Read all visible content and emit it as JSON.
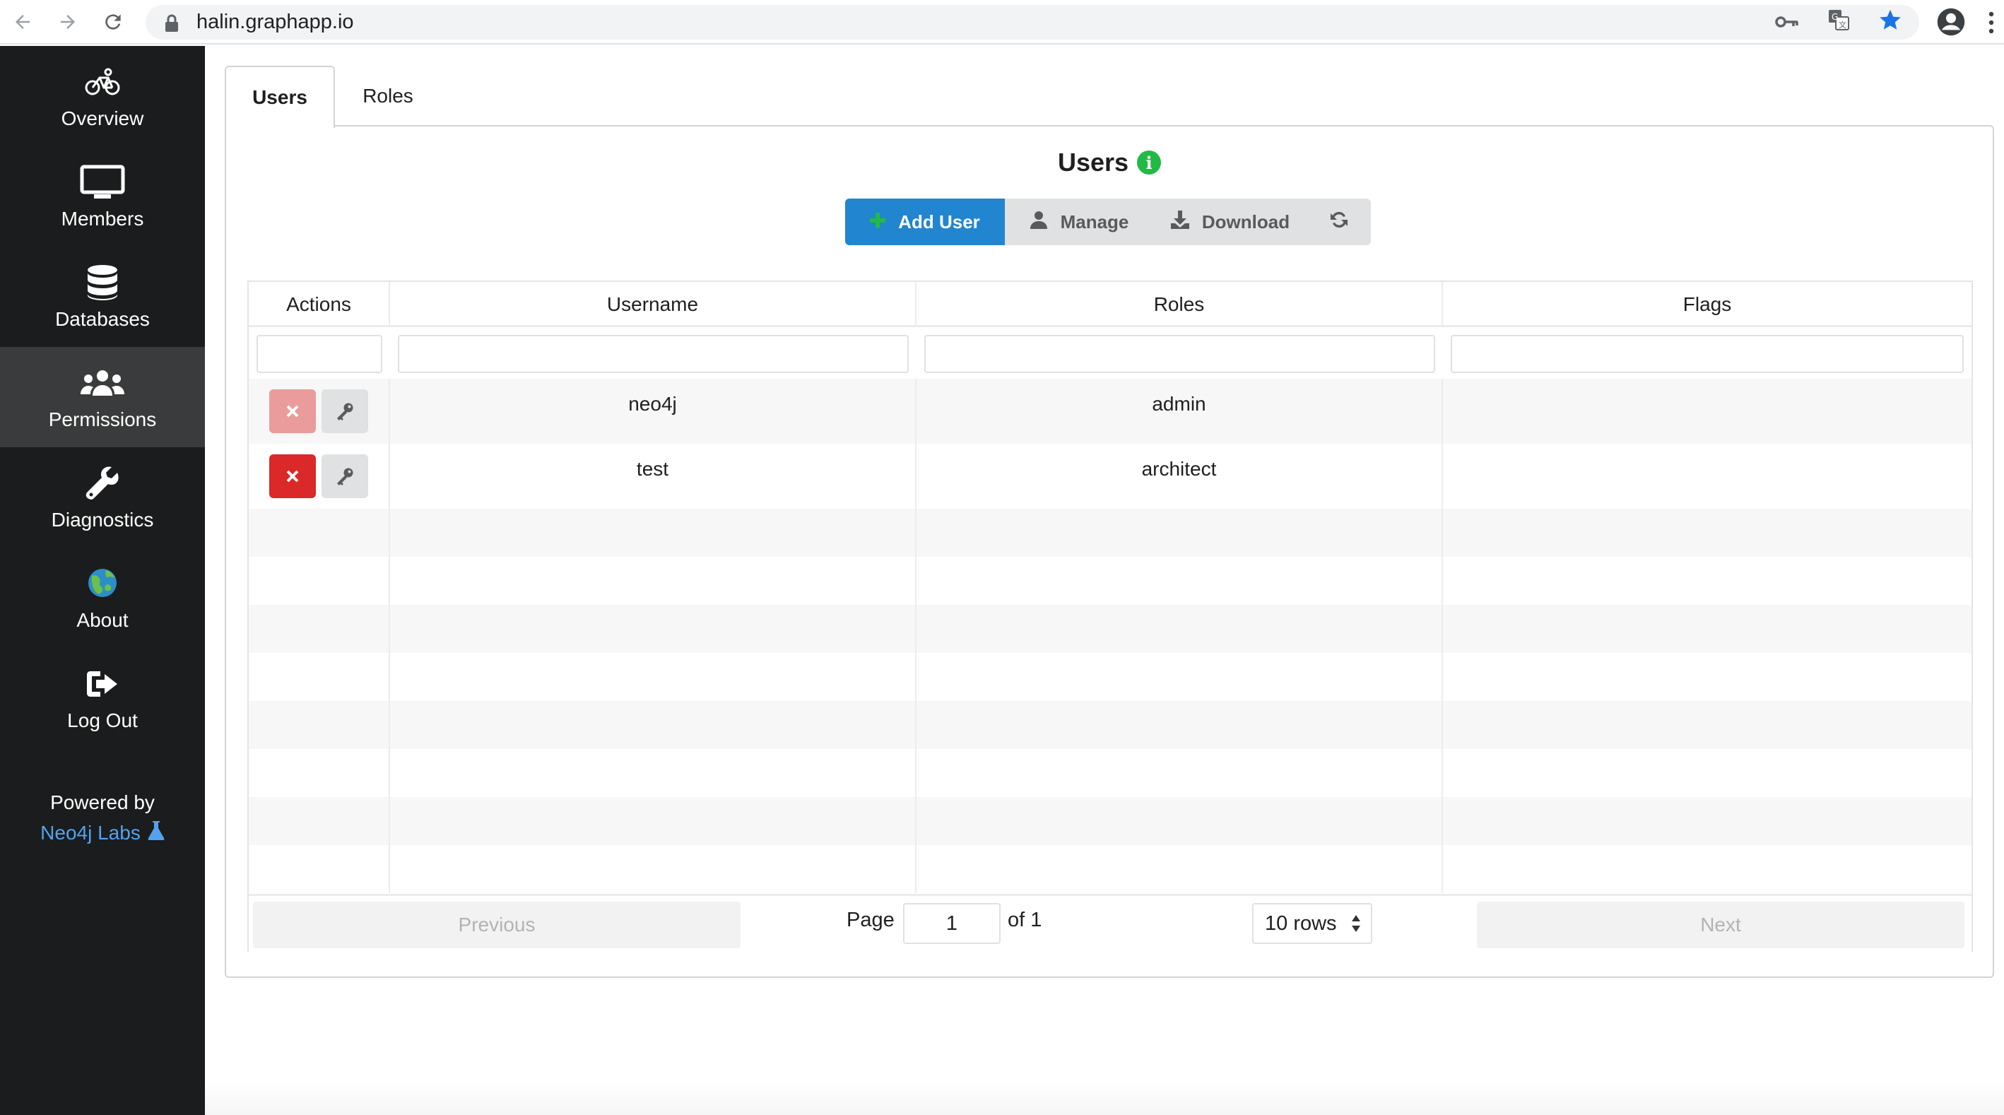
{
  "browser": {
    "url": "halin.graphapp.io",
    "icons": [
      "back-icon",
      "forward-icon",
      "reload-icon",
      "lock-icon",
      "key-icon",
      "translate-icon",
      "star-icon",
      "profile-icon",
      "menu-icon"
    ]
  },
  "sidebar": {
    "items": [
      {
        "label": "Overview",
        "icon": "bicycle-icon"
      },
      {
        "label": "Members",
        "icon": "monitor-icon"
      },
      {
        "label": "Databases",
        "icon": "database-icon"
      },
      {
        "label": "Permissions",
        "icon": "users-icon",
        "active": true
      },
      {
        "label": "Diagnostics",
        "icon": "wrench-icon"
      },
      {
        "label": "About",
        "icon": "globe-icon"
      },
      {
        "label": "Log Out",
        "icon": "logout-icon"
      }
    ],
    "powered_by": "Powered by",
    "neo4j_labs": "Neo4j Labs"
  },
  "tabs": [
    {
      "label": "Users",
      "active": true
    },
    {
      "label": "Roles",
      "active": false
    }
  ],
  "panel": {
    "title": "Users",
    "info_glyph": "i"
  },
  "toolbar": {
    "add_user": "Add User",
    "manage": "Manage",
    "download": "Download"
  },
  "table": {
    "columns": [
      "Actions",
      "Username",
      "Roles",
      "Flags"
    ],
    "rows": [
      {
        "username": "neo4j",
        "roles": "admin",
        "flags": "",
        "delete_disabled": true
      },
      {
        "username": "test",
        "roles": "architect",
        "flags": "",
        "delete_disabled": false
      }
    ],
    "empty_rows": 8
  },
  "pagination": {
    "previous": "Previous",
    "next": "Next",
    "page_label": "Page",
    "page_value": "1",
    "of_label": "of 1",
    "rows_option": "10 rows"
  },
  "colors": {
    "sidebar_bg": "#1b1c1d",
    "sidebar_active": "#3a3b3c",
    "primary": "#2185d0",
    "danger": "#db2828",
    "info": "#21ba45",
    "link": "#54a2ee"
  }
}
